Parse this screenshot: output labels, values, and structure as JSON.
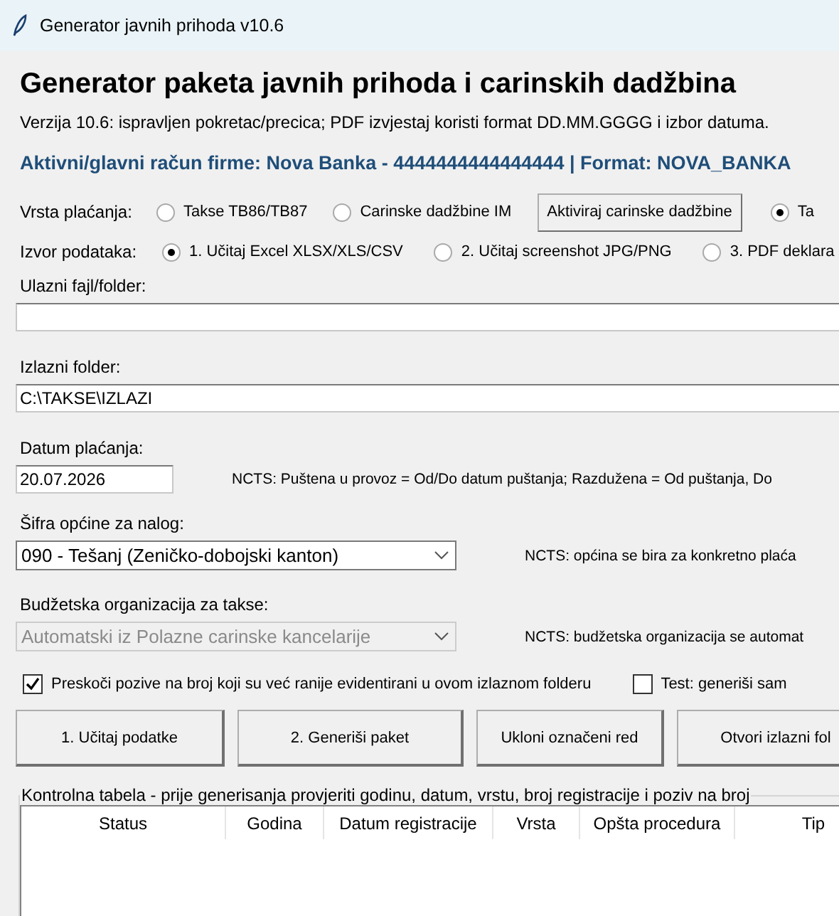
{
  "window": {
    "title": "Generator javnih prihoda v10.6"
  },
  "header": {
    "title": "Generator paketa javnih prihoda i carinskih dadžbina",
    "subtitle": "Verzija 10.6: ispravljen pokretac/precica; PDF izvjestaj koristi format DD.MM.GGGG i izbor datuma.",
    "account": "Aktivni/glavni račun firme: Nova Banka - 4444444444444444 | Format: NOVA_BANKA"
  },
  "payment_type": {
    "label": "Vrsta plaćanja:",
    "items": [
      {
        "kind": "radio",
        "label": "Takse TB86/TB87",
        "selected": false
      },
      {
        "kind": "radio",
        "label": "Carinske dadžbine IM",
        "selected": false
      },
      {
        "kind": "button",
        "label": "Aktiviraj carinske dadžbine"
      },
      {
        "kind": "radio",
        "label": "Ta",
        "selected": true
      }
    ]
  },
  "data_source": {
    "label": "Izvor podataka:",
    "items": [
      {
        "kind": "radio",
        "label": "1. Učitaj Excel XLSX/XLS/CSV",
        "selected": true
      },
      {
        "kind": "radio",
        "label": "2. Učitaj screenshot JPG/PNG",
        "selected": false
      },
      {
        "kind": "radio",
        "label": "3. PDF deklara",
        "selected": false
      }
    ]
  },
  "input_path": {
    "label": "Ulazni fajl/folder:"
  },
  "output_folder": {
    "label": "Izlazni folder:",
    "value": "C:\\TAKSE\\IZLAZI"
  },
  "payment_date": {
    "label": "Datum plaćanja:",
    "value": "20.07.2026",
    "note": "NCTS: Puštena u provoz = Od/Do datum puštanja; Razdužena = Od puštanja, Do"
  },
  "municipality": {
    "label": "Šifra općine za nalog:",
    "value": "090 - Tešanj (Zeničko-dobojski kanton)",
    "disabled": false,
    "note": "NCTS: općina se bira za konkretno plaća"
  },
  "budget_org": {
    "label": "Budžetska organizacija za takse:",
    "value": "Automatski iz Polazne carinske kancelarije",
    "disabled": true,
    "note": "NCTS: budžetska organizacija se automat"
  },
  "options": [
    {
      "label": "Preskoči pozive na broj koji su već ranije evidentirani u ovom izlaznom folderu",
      "checked": true
    },
    {
      "label": "Test: generiši sam",
      "checked": false
    }
  ],
  "buttons": [
    "1. Učitaj podatke",
    "2. Generiši paket",
    "Ukloni označeni red",
    "Otvori izlazni fol"
  ],
  "table": {
    "caption": "Kontrolna tabela - prije generisanja provjeriti godinu, datum, vrstu, broj registracije i poziv na broj",
    "columns": [
      "Status",
      "Godina",
      "Datum registracije",
      "Vrsta",
      "Opšta procedura",
      "Tip"
    ]
  }
}
